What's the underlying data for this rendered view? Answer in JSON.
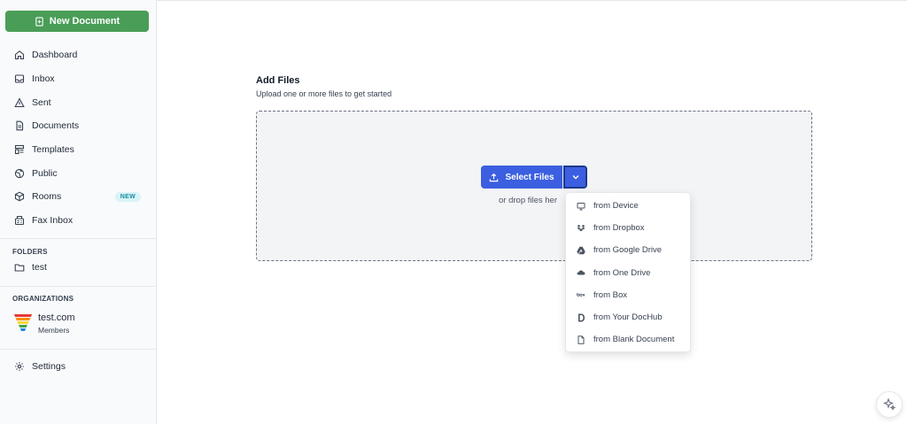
{
  "sidebar": {
    "new_document_label": "New Document",
    "nav": [
      {
        "label": "Dashboard",
        "icon": "home-icon"
      },
      {
        "label": "Inbox",
        "icon": "inbox-icon"
      },
      {
        "label": "Sent",
        "icon": "send-icon"
      },
      {
        "label": "Documents",
        "icon": "document-icon"
      },
      {
        "label": "Templates",
        "icon": "template-icon"
      },
      {
        "label": "Public",
        "icon": "globe-icon"
      },
      {
        "label": "Rooms",
        "icon": "cube-icon",
        "badge": "NEW"
      },
      {
        "label": "Fax Inbox",
        "icon": "fax-icon"
      }
    ],
    "folders_label": "FOLDERS",
    "folders": [
      {
        "label": "test",
        "icon": "folder-icon"
      }
    ],
    "organizations_label": "ORGANIZATIONS",
    "organization": {
      "name": "test.com",
      "role": "Members"
    },
    "settings_label": "Settings"
  },
  "main": {
    "title": "Add Files",
    "subtitle": "Upload one or more files to get started",
    "select_files_label": "Select Files",
    "drop_text": "or drop files her",
    "menu": [
      {
        "label": "from Device",
        "icon": "monitor-icon"
      },
      {
        "label": "from Dropbox",
        "icon": "dropbox-icon"
      },
      {
        "label": "from Google Drive",
        "icon": "google-drive-icon"
      },
      {
        "label": "from One Drive",
        "icon": "onedrive-icon"
      },
      {
        "label": "from Box",
        "icon": "box-icon"
      },
      {
        "label": "from Your DocHub",
        "icon": "dochub-icon"
      },
      {
        "label": "from Blank Document",
        "icon": "blank-document-icon"
      }
    ]
  },
  "colors": {
    "accent_green": "#4a9d57",
    "accent_blue": "#3b5fe0",
    "badge_bg": "#d9f3f7",
    "badge_text": "#1a8a9c"
  }
}
